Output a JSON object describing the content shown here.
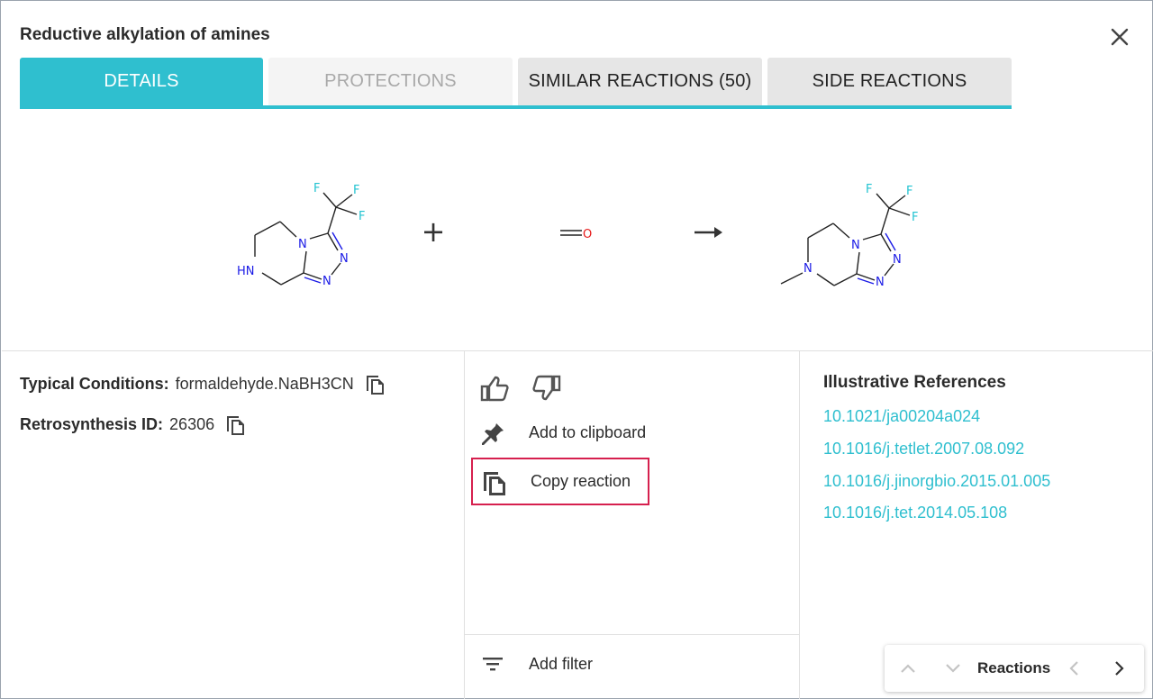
{
  "dialog": {
    "title": "Reductive alkylation of amines"
  },
  "tabs": [
    {
      "label": "DETAILS",
      "state": "active"
    },
    {
      "label": "PROTECTIONS",
      "state": "disabled"
    },
    {
      "label": "SIMILAR REACTIONS (50)",
      "state": "normal"
    },
    {
      "label": "SIDE REACTIONS",
      "state": "normal"
    }
  ],
  "reaction": {
    "plus": "+",
    "arrow": "→",
    "reactant1": {
      "atoms": {
        "nh": "HN",
        "n1": "N",
        "n2": "N",
        "n3": "N",
        "f1": "F",
        "f2": "F",
        "f3": "F"
      }
    },
    "reactant2": {
      "atoms": {
        "o": "O"
      }
    },
    "product": {
      "atoms": {
        "n0": "N",
        "n1": "N",
        "n2": "N",
        "n3": "N",
        "f1": "F",
        "f2": "F",
        "f3": "F"
      }
    },
    "colors": {
      "nitrogen": "#1a1ae6",
      "fluorine": "#21c3d1",
      "oxygen": "#e61a1a",
      "carbon": "#222222"
    }
  },
  "details": {
    "conditions_label": "Typical Conditions:",
    "conditions_value": "formaldehyde.NaBH3CN",
    "retro_label": "Retrosynthesis ID:",
    "retro_value": "26306"
  },
  "actions": {
    "add_clipboard": "Add to clipboard",
    "copy_reaction": "Copy reaction",
    "add_filter": "Add filter"
  },
  "references": {
    "title": "Illustrative References",
    "items": [
      "10.1021/ja00204a024",
      "10.1016/j.tetlet.2007.08.092",
      "10.1016/j.jinorgbio.2015.01.005",
      "10.1016/j.tet.2014.05.108"
    ]
  },
  "navigator": {
    "label": "Reactions"
  },
  "colors": {
    "accent": "#2fbfcf",
    "highlight": "#d6204e"
  }
}
